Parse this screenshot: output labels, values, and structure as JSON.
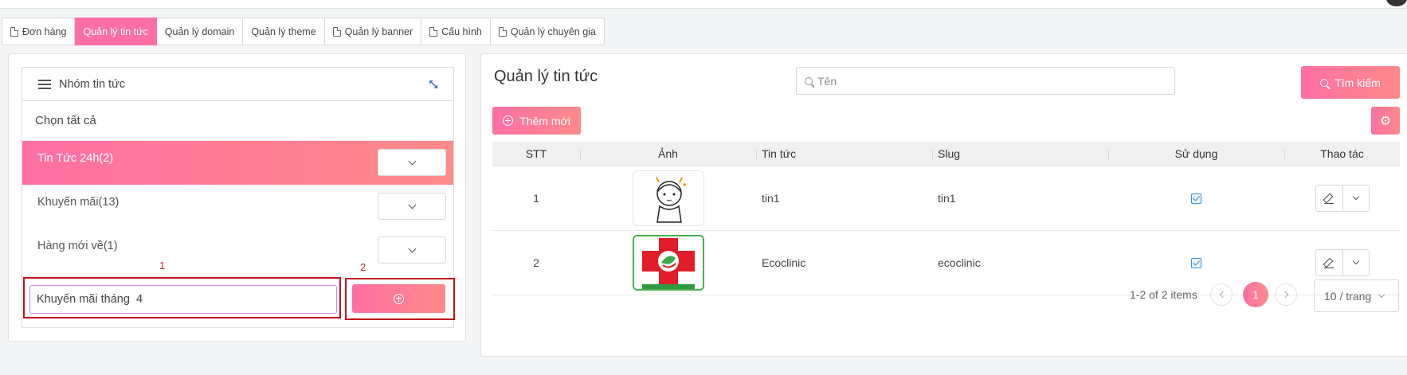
{
  "tabs": [
    {
      "label": "Đơn hàng",
      "icon": "document-icon",
      "active": false
    },
    {
      "label": "Quản lý tin tức",
      "icon": "",
      "active": true
    },
    {
      "label": "Quản lý domain",
      "icon": "",
      "active": false
    },
    {
      "label": "Quản lý theme",
      "icon": "",
      "active": false
    },
    {
      "label": "Quản lý banner",
      "icon": "document-icon",
      "active": false
    },
    {
      "label": "Cấu hình",
      "icon": "document-icon",
      "active": false
    },
    {
      "label": "Quản lý chuyên gia",
      "icon": "document-icon",
      "active": false
    }
  ],
  "groups": {
    "title": "Nhóm tin tức",
    "select_all": "Chọn tất cả",
    "items": [
      {
        "label": "Tin Tức 24h(2)",
        "active": true
      },
      {
        "label": "Khuyến mãi(13)",
        "active": false
      },
      {
        "label": "Hàng mới về(1)",
        "active": false
      }
    ],
    "new_group_value": "Khuyến mãi tháng  4",
    "annotation_1": "1",
    "annotation_2": "2"
  },
  "main": {
    "title": "Quản lý tin tức",
    "search_placeholder": "Tên",
    "search_button": "Tìm kiếm",
    "add_button": "Thêm mới",
    "columns": [
      "STT",
      "Ảnh",
      "Tin tức",
      "Slug",
      "Sử dụng",
      "Thao tác"
    ],
    "rows": [
      {
        "stt": "1",
        "image": "cartoon-girl-thumbnail",
        "news": "tin1",
        "slug": "tin1",
        "in_use": true
      },
      {
        "stt": "2",
        "image": "ecoclinic-logo-thumbnail",
        "news": "Ecoclinic",
        "slug": "ecoclinic",
        "in_use": true
      }
    ],
    "pagination": {
      "summary": "1-2 of 2 items",
      "current_page": "1",
      "page_size": "10 / trang"
    }
  },
  "colors": {
    "accent": "#ff6fa5",
    "accent_gradient_end": "#ff8a8a",
    "annotation_red": "#c0121b",
    "checkbox_blue": "#3b8ed8"
  }
}
